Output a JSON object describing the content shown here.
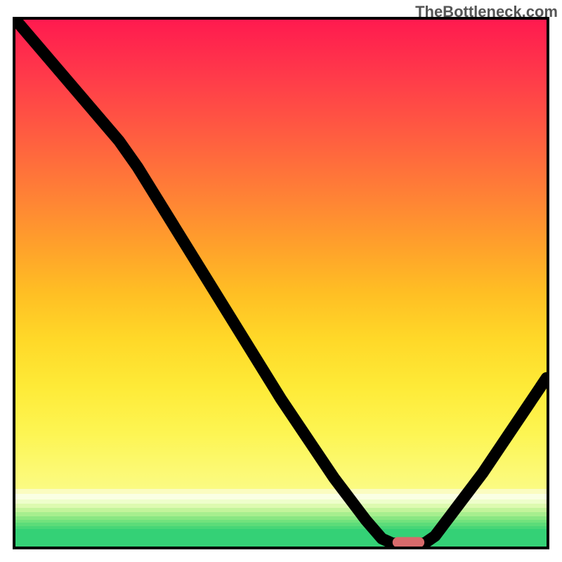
{
  "watermark": "TheBottleneck.com",
  "chart_data": {
    "type": "line",
    "title": "",
    "xlabel": "",
    "ylabel": "",
    "xlim": [
      0,
      100
    ],
    "ylim": [
      0,
      100
    ],
    "curve": [
      {
        "x": 0.0,
        "y": 100.0
      },
      {
        "x": 19.5,
        "y": 77.0
      },
      {
        "x": 23.0,
        "y": 72.0
      },
      {
        "x": 50.0,
        "y": 28.0
      },
      {
        "x": 60.0,
        "y": 13.0
      },
      {
        "x": 66.0,
        "y": 5.0
      },
      {
        "x": 69.0,
        "y": 1.5
      },
      {
        "x": 71.0,
        "y": 0.6
      },
      {
        "x": 77.0,
        "y": 0.6
      },
      {
        "x": 79.0,
        "y": 2.0
      },
      {
        "x": 88.0,
        "y": 14.0
      },
      {
        "x": 100.0,
        "y": 32.0
      }
    ],
    "marker": {
      "x_center": 74.0,
      "y": 0.8,
      "width": 6.0,
      "height": 2.0,
      "color": "#d86a6b"
    },
    "gradient_stops": [
      {
        "pos": 0,
        "color": "#ff1a4f"
      },
      {
        "pos": 48,
        "color": "#ffa02b"
      },
      {
        "pos": 78,
        "color": "#feea37"
      },
      {
        "pos": 97,
        "color": "#34d176"
      }
    ]
  }
}
